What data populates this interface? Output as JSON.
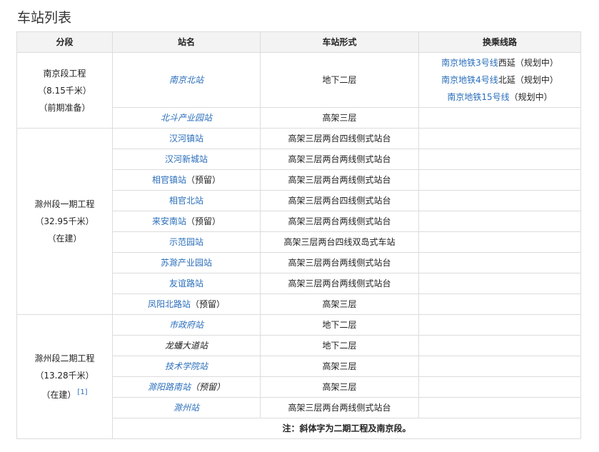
{
  "title": "车站列表",
  "headers": {
    "segment": "分段",
    "station": "站名",
    "form": "车站形式",
    "transfer": "换乘线路"
  },
  "segments": {
    "nanjing": {
      "name": "南京段工程",
      "length": "（8.15千米）",
      "status": "（前期准备）"
    },
    "phase1": {
      "name": "滁州段一期工程",
      "length": "（32.95千米）",
      "status": "（在建）"
    },
    "phase2": {
      "name": "滁州段二期工程",
      "length": "（13.28千米）",
      "status": "（在建）",
      "ref": "[1]"
    }
  },
  "stations": {
    "nanjingbei": {
      "name": "南京北站",
      "form": "地下二层"
    },
    "beidou": {
      "name": "北斗产业园站",
      "form": "高架三层"
    },
    "hanhezhen": {
      "name": "汉河镇站",
      "form": "高架三层两台四线侧式站台"
    },
    "hanhexincheng": {
      "name": "汉河新城站",
      "form": "高架三层两台两线侧式站台"
    },
    "xiangguanzhen": {
      "name": "相官镇站",
      "suffix": "（预留）",
      "form": "高架三层两台两线侧式站台"
    },
    "xiangguanbei": {
      "name": "相官北站",
      "form": "高架三层两台四线侧式站台"
    },
    "laian": {
      "name": "来安南站",
      "suffix": "（预留）",
      "form": "高架三层两台两线侧式站台"
    },
    "shifanyuan": {
      "name": "示范园站",
      "form": "高架三层两台四线双岛式车站"
    },
    "suchu": {
      "name": "苏滁产业园站",
      "form": "高架三层两台两线侧式站台"
    },
    "youyi": {
      "name": "友谊路站",
      "form": "高架三层两台两线侧式站台"
    },
    "fengyang": {
      "name": "凤阳北路站",
      "suffix": "（预留）",
      "form": "高架三层"
    },
    "shizhengfu": {
      "name": "市政府站",
      "form": "地下二层"
    },
    "longpan": {
      "name": "龙蟠大道站",
      "form": "地下二层"
    },
    "jishu": {
      "name": "技术学院站",
      "form": "高架三层"
    },
    "chuyang": {
      "name": "滁阳路南站",
      "suffix": "（预留）",
      "form": "高架三层"
    },
    "chuzhou": {
      "name": "滁州站",
      "form": "高架三层两台两线侧式站台"
    }
  },
  "transfers": {
    "line3": {
      "link": "南京地铁3号线",
      "rest": "西延（规划中）"
    },
    "line4": {
      "link": "南京地铁4号线",
      "rest": "北延（规划中）"
    },
    "line15": {
      "link": "南京地铁15号线",
      "rest": "（规划中）"
    }
  },
  "note": "注：斜体字为二期工程及南京段。"
}
